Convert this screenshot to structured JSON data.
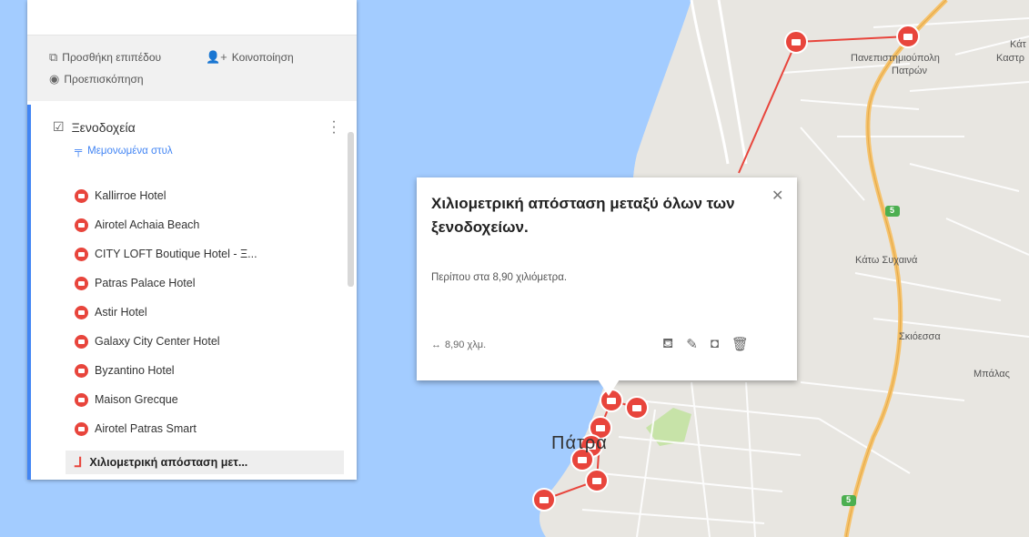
{
  "panel": {
    "actions": {
      "add_layer": "Προσθήκη επιπέδου",
      "share": "Κοινοποίηση",
      "preview": "Προεπισκόπηση"
    },
    "layer": {
      "title": "Ξενοδοχεία",
      "checked": true,
      "style_link": "Μεμονωμένα στυλ",
      "items": [
        {
          "label": "Kallirroe Hotel"
        },
        {
          "label": "Airotel Achaia Beach"
        },
        {
          "label": "CITY LOFT Boutique Hotel - Ξ..."
        },
        {
          "label": "Patras Palace Hotel"
        },
        {
          "label": "Astir Hotel"
        },
        {
          "label": "Galaxy City Center Hotel"
        },
        {
          "label": "Byzantino Hotel"
        },
        {
          "label": "Maison Grecque"
        },
        {
          "label": "Airotel Patras Smart"
        }
      ],
      "line_item": "Χιλιομετρική απόσταση μετ..."
    },
    "accent_color": "#4285f4"
  },
  "popup": {
    "title": "Χιλιομετρική απόσταση μεταξύ όλων των ξενοδοχείων.",
    "description": "Περίπου στα 8,90 χιλιόμετρα.",
    "distance": "8,90 χλμ.",
    "tools": [
      "paint-bucket-icon",
      "pencil-icon",
      "camera-icon",
      "trash-icon"
    ]
  },
  "map": {
    "city": "Πάτρα",
    "labels": {
      "university": "Πανεπιστημιούπολη",
      "university2": "Πατρών",
      "kato_sychaina": "Κάτω Συχαινά",
      "skioessa": "Σκιόεσσα",
      "mpalas": "Μπάλας",
      "kastro1": "Κάτ",
      "kastro2": "Καστρ"
    },
    "route_number": "5",
    "marker_color": "#e8453c"
  }
}
